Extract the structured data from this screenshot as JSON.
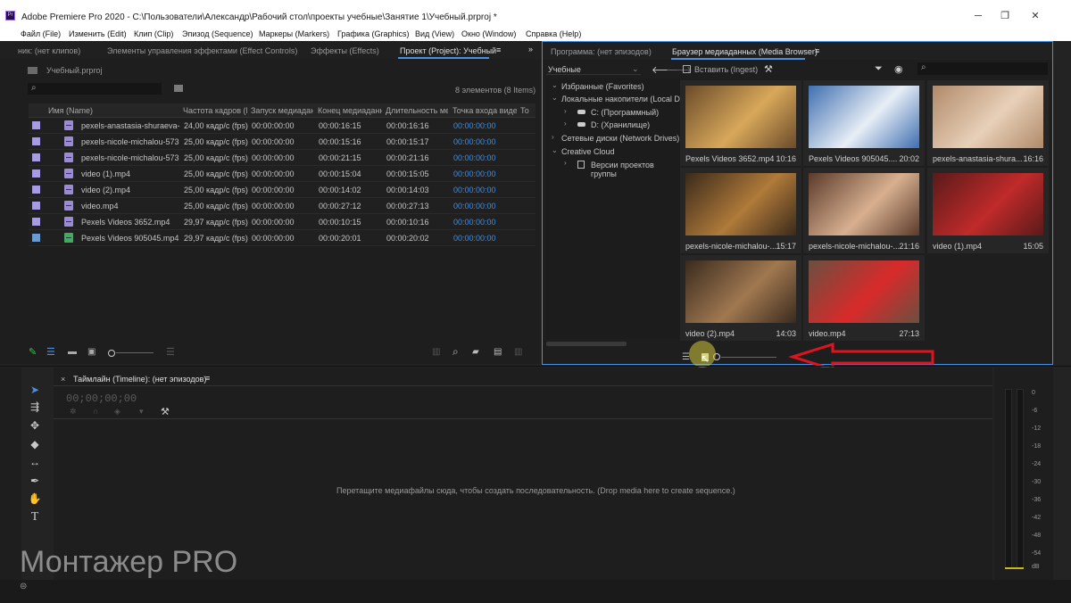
{
  "window": {
    "title": "Adobe Premiere Pro 2020 - C:\\Пользователи\\Александр\\Рабочий стол\\проекты учебные\\Занятие 1\\Учебный.prproj *",
    "app_icon_text": "Pr"
  },
  "menu": [
    "Файл (File)",
    "Изменить (Edit)",
    "Клип (Clip)",
    "Эпизод (Sequence)",
    "Маркеры (Markers)",
    "Графика (Graphics)",
    "Вид (View)",
    "Окно (Window)",
    "Справка (Help)"
  ],
  "left_tabs": {
    "source": "ник: (нет клипов)",
    "effect_controls": "Элементы управления эффектами (Effect Controls)",
    "effects": "Эффекты (Effects)",
    "project": "Проект (Project): Учебный"
  },
  "project": {
    "file": "Учебный.prproj",
    "search_placeholder": "",
    "count": "8 элементов (8 Items)",
    "columns": [
      "Имя (Name)",
      "Частота кадров (F",
      "Запуск медиадан",
      "Конец медиаданн",
      "Длительность ме",
      "Точка входа виде",
      "То"
    ],
    "rows": [
      {
        "name": "pexels-anastasia-shuraeva-",
        "fps": "24,00 кадр/с (fps)",
        "start": "00:00:00:00",
        "end": "00:00:16:15",
        "dur": "00:00:16:16",
        "in": "00:00:00:00",
        "type": "video"
      },
      {
        "name": "pexels-nicole-michalou-573",
        "fps": "25,00 кадр/с (fps)",
        "start": "00:00:00:00",
        "end": "00:00:15:16",
        "dur": "00:00:15:17",
        "in": "00:00:00:00",
        "type": "video"
      },
      {
        "name": "pexels-nicole-michalou-573",
        "fps": "25,00 кадр/с (fps)",
        "start": "00:00:00:00",
        "end": "00:00:21:15",
        "dur": "00:00:21:16",
        "in": "00:00:00:00",
        "type": "video"
      },
      {
        "name": "video (1).mp4",
        "fps": "25,00 кадр/с (fps)",
        "start": "00:00:00:00",
        "end": "00:00:15:04",
        "dur": "00:00:15:05",
        "in": "00:00:00:00",
        "type": "video"
      },
      {
        "name": "video (2).mp4",
        "fps": "25,00 кадр/с (fps)",
        "start": "00:00:00:00",
        "end": "00:00:14:02",
        "dur": "00:00:14:03",
        "in": "00:00:00:00",
        "type": "video"
      },
      {
        "name": "video.mp4",
        "fps": "25,00 кадр/с (fps)",
        "start": "00:00:00:00",
        "end": "00:00:27:12",
        "dur": "00:00:27:13",
        "in": "00:00:00:00",
        "type": "video"
      },
      {
        "name": "Pexels Videos 3652.mp4",
        "fps": "29,97 кадр/с (fps)",
        "start": "00:00:00:00",
        "end": "00:00:10:15",
        "dur": "00:00:10:16",
        "in": "00:00:00:00",
        "type": "video"
      },
      {
        "name": "Pexels Videos 905045.mp4",
        "fps": "29,97 кадр/с (fps)",
        "start": "00:00:00:00",
        "end": "00:00:20:01",
        "dur": "00:00:20:02",
        "in": "00:00:00:00",
        "type": "sequence"
      }
    ]
  },
  "right_tabs": {
    "program": "Программа: (нет эпизодов)",
    "media_browser": "Браузер медиаданных (Media Browser)"
  },
  "media_browser": {
    "location": "Учебные",
    "ingest": "Вставить (Ingest)",
    "tree": [
      "Избранные (Favorites)",
      "Локальные накопители (Local Driv",
      "C: (Программный)",
      "D: (Хранилище)",
      "Сетевые диски (Network Drives)",
      "Creative Cloud",
      "Версии проектов группы"
    ],
    "thumbs": [
      {
        "name": "Pexels Videos 3652.mp4",
        "dur": "10:16",
        "color1": "#6a4a2a",
        "color2": "#d8a85a"
      },
      {
        "name": "Pexels Videos 905045....",
        "dur": "20:02",
        "color1": "#3f6fb0",
        "color2": "#e8eef6"
      },
      {
        "name": "pexels-anastasia-shura...",
        "dur": "16:16",
        "color1": "#b08a6a",
        "color2": "#e8d0b8"
      },
      {
        "name": "pexels-nicole-michalou-...",
        "dur": "15:17",
        "color1": "#3a2a1a",
        "color2": "#b07a3a"
      },
      {
        "name": "pexels-nicole-michalou-...",
        "dur": "21:16",
        "color1": "#5a3a2a",
        "color2": "#d8b090"
      },
      {
        "name": "video (1).mp4",
        "dur": "15:05",
        "color1": "#5a1a1a",
        "color2": "#c02a2a"
      },
      {
        "name": "video (2).mp4",
        "dur": "14:03",
        "color1": "#3a2a1e",
        "color2": "#a07850"
      },
      {
        "name": "video.mp4",
        "dur": "27:13",
        "color1": "#6a5040",
        "color2": "#d82a2a"
      }
    ]
  },
  "timeline": {
    "title": "Таймлайн (Timeline): (нет эпизодов)",
    "timecode": "00;00;00;00",
    "drop_hint": "Перетащите медиафайлы сюда, чтобы создать последовательность. (Drop media here to create sequence.)"
  },
  "meter_labels": [
    "0",
    "-6",
    "-12",
    "-18",
    "-24",
    "-30",
    "-36",
    "-42",
    "-48",
    "-54",
    "dB"
  ],
  "watermark": "Монтажер PRO",
  "annotation_color": "#e0141e",
  "accent": "#4b8fe0"
}
